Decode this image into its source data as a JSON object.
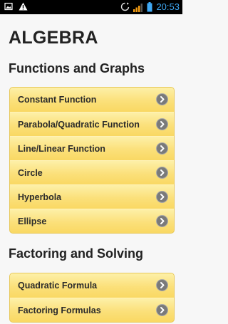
{
  "status_bar": {
    "time": "20:53",
    "time_color": "#3fa9f5",
    "left_icons": [
      "image-notification-icon",
      "warning-icon"
    ],
    "right_icons": [
      "sync-icon",
      "signal-icon",
      "battery-icon"
    ]
  },
  "app_title": "ALGEBRA",
  "sections": [
    {
      "title": "Functions and Graphs",
      "items": [
        {
          "label": "Constant Function"
        },
        {
          "label": "Parabola/Quadratic Function"
        },
        {
          "label": "Line/Linear Function"
        },
        {
          "label": "Circle"
        },
        {
          "label": "Hyperbola"
        },
        {
          "label": "Ellipse"
        }
      ]
    },
    {
      "title": "Factoring and Solving",
      "items": [
        {
          "label": "Quadratic Formula"
        },
        {
          "label": "Factoring Formulas"
        }
      ]
    }
  ],
  "colors": {
    "item_fill": "#fbe07a",
    "item_border": "#e7c85a",
    "chevron": "#7a7a7a",
    "background": "#f7f7f7"
  }
}
